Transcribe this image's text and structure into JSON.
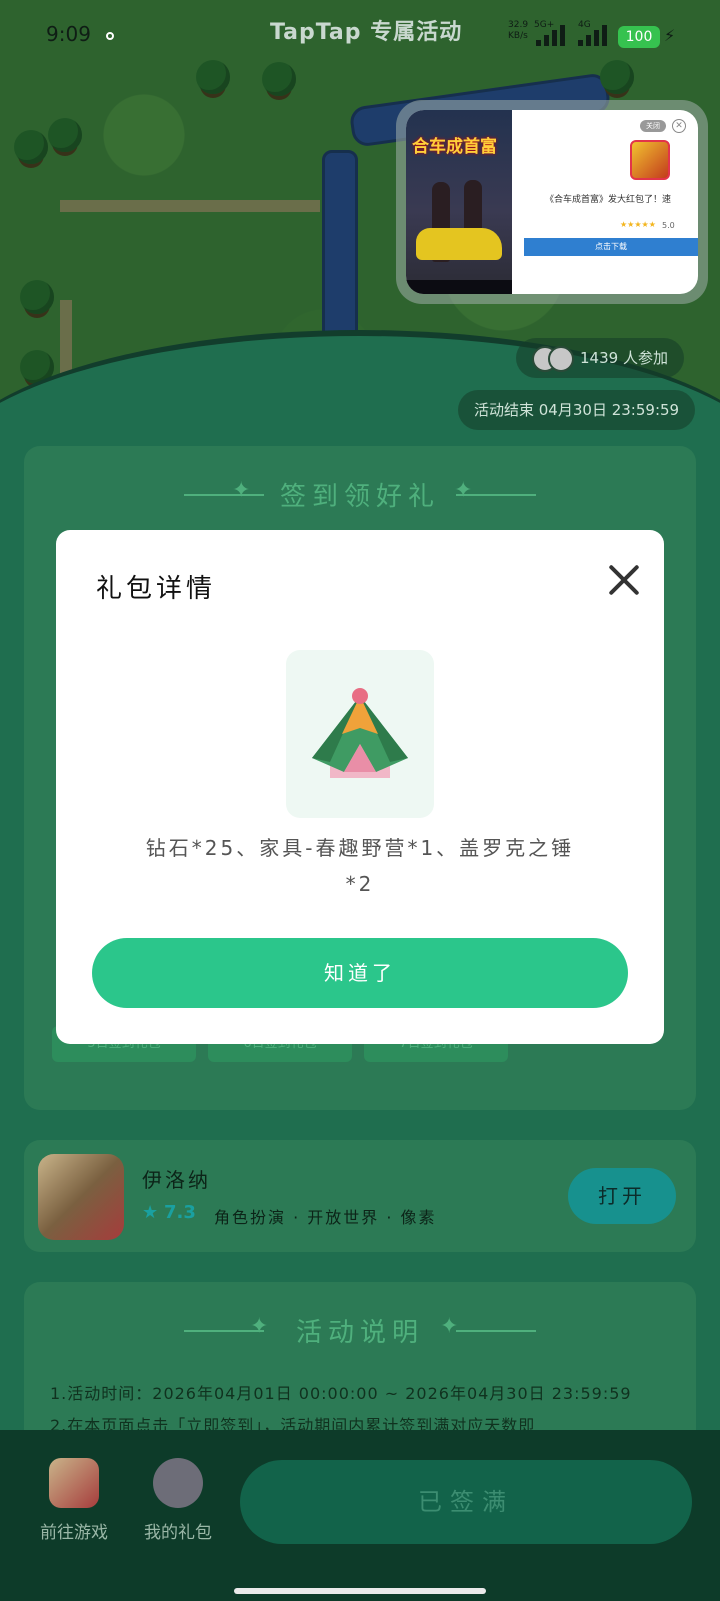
{
  "status_bar": {
    "time": "9:09",
    "header_title": "TapTap 专属活动",
    "net_speed": "32.9",
    "net_unit": "KB/s",
    "net_type_1": "5G+",
    "net_type_2": "4G",
    "battery": "100"
  },
  "ad": {
    "image_title": "合车成首富",
    "tag": "关闭",
    "description": "《合车成首富》发大红包了！速",
    "score": "5.0",
    "button": "点击下载"
  },
  "event": {
    "participants": "1439 人参加",
    "end_time": "活动结束 04月30日 23:59:59"
  },
  "signin": {
    "title": "签到领好礼",
    "chips": [
      "5日签到礼包",
      "6日签到礼包",
      "7日签到礼包"
    ]
  },
  "game": {
    "name": "伊洛纳",
    "score": "7.3",
    "tags": "角色扮演 · 开放世界 · 像素",
    "open_button": "打开"
  },
  "rules": {
    "title": "活动说明",
    "lines": [
      "1.活动时间：2026年04月01日 00:00:00 ~ 2026年04月30日 23:59:59",
      "2.在本页面点击「立即签到」，活动期间内累计签到满对应天数即"
    ]
  },
  "bottom_bar": {
    "go_game": "前往游戏",
    "my_gifts": "我的礼包",
    "signed_button": "已签满"
  },
  "modal": {
    "title": "礼包详情",
    "description_line1": "钻石*25、家具-春趣野营*1、盖罗克之锤",
    "description_line2": "*2",
    "ok_button": "知道了"
  },
  "colors": {
    "accent": "#2bc68b",
    "background": "#1f6e4f"
  }
}
